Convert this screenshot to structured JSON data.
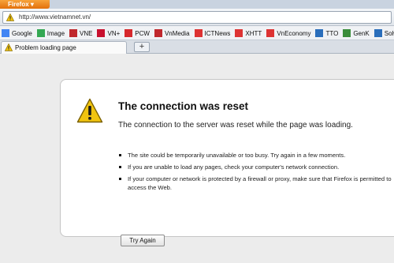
{
  "app": {
    "menu_button": "Firefox"
  },
  "navbar": {
    "url": "http://www.vietnamnet.vn/"
  },
  "bookmarks": [
    {
      "label": "Google",
      "icon": "google-icon",
      "color": "#4285f4"
    },
    {
      "label": "Image",
      "icon": "google-image-icon",
      "color": "#34a853"
    },
    {
      "label": "VNE",
      "icon": "vne-icon",
      "color": "#c0282d"
    },
    {
      "label": "VN+",
      "icon": "vnplus-icon",
      "color": "#c8102e"
    },
    {
      "label": "PCW",
      "icon": "pcw-icon",
      "color": "#d6282c"
    },
    {
      "label": "VnMedia",
      "icon": "vnmedia-icon",
      "color": "#c0282d"
    },
    {
      "label": "ICTNews",
      "icon": "ictnews-icon",
      "color": "#d33"
    },
    {
      "label": "XHTT",
      "icon": "xhtt-icon",
      "color": "#d33"
    },
    {
      "label": "VnEconomy",
      "icon": "vneconomy-icon",
      "color": "#d33"
    },
    {
      "label": "TTO",
      "icon": "tto-icon",
      "color": "#2a6ebb"
    },
    {
      "label": "GenK",
      "icon": "genk-icon",
      "color": "#3a8d3a"
    },
    {
      "label": "SoHo",
      "icon": "soho-icon",
      "color": "#2a6ebb"
    }
  ],
  "tabs": [
    {
      "title": "Problem loading page"
    }
  ],
  "error": {
    "title": "The connection was reset",
    "description": "The connection to the server was reset while the page was loading.",
    "bullets": [
      "The site could be temporarily unavailable or too busy. Try again in a few moments.",
      "If you are unable to load any pages, check your computer's network connection.",
      "If your computer or network is protected by a firewall or proxy, make sure that Firefox is permitted to access the Web."
    ],
    "try_again_label": "Try Again"
  },
  "colors": {
    "warning": "#f1c40f",
    "firefox_orange": "#e2700b"
  }
}
